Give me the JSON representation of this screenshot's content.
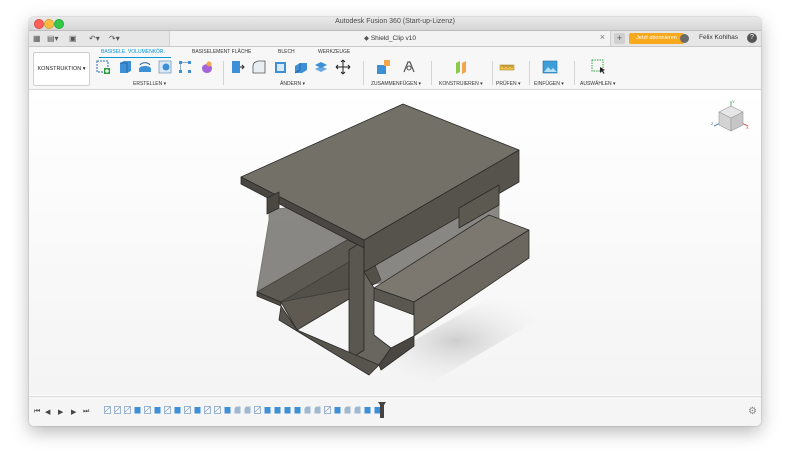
{
  "window": {
    "title": "Autodesk Fusion 360 (Start-up-Lizenz)"
  },
  "tabbar": {
    "document_title": "Shield_Clip v10",
    "close_glyph": "×",
    "plus_glyph": "+",
    "subscribe_label": "Jetzt abonnieren",
    "user_name": "Felix Kohlhas",
    "help_glyph": "?"
  },
  "toolbar": {
    "workspace_label": "KONSTRUKTION ▾",
    "tabs": [
      {
        "label": "BASISELE. VOLUMENKÖR.",
        "active": true
      },
      {
        "label": "BASISELEMENT FLÄCHE",
        "active": false
      },
      {
        "label": "BLECH",
        "active": false
      },
      {
        "label": "WERKZEUGE",
        "active": false
      }
    ],
    "groups": [
      {
        "label": "ERSTELLEN ▾"
      },
      {
        "label": "ÄNDERN ▾"
      },
      {
        "label": "ZUSAMMENFÜGEN ▾"
      },
      {
        "label": "KONSTRUIEREN ▾"
      },
      {
        "label": "PRÜFEN ▾"
      },
      {
        "label": "EINFÜGEN ▾"
      },
      {
        "label": "AUSWÄHLEN ▾"
      }
    ]
  },
  "viewcube": {
    "axis_x": "X",
    "axis_y": "Y",
    "axis_z": "Z"
  },
  "timeline": {
    "controls": [
      "⏮",
      "◀",
      "▶",
      "▶",
      "⏭"
    ],
    "gear_glyph": "⚙"
  },
  "colors": {
    "accent": "#0696d7",
    "subscribe": "#f7a81b",
    "model": "#6e6b63"
  }
}
